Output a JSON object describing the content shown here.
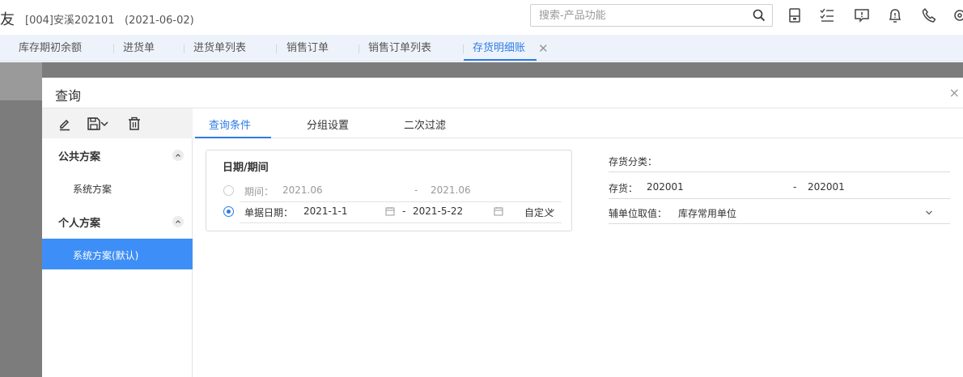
{
  "header": {
    "brand_fragment": "友",
    "account": "[004]安溪202101",
    "account_date": "(2021-06-02)",
    "search_placeholder": "搜索-产品功能",
    "icons": [
      "search-icon",
      "save-file-icon",
      "checklist-icon",
      "message-icon",
      "bell-icon",
      "phone-icon",
      "settings-icon"
    ]
  },
  "tabs": [
    {
      "label": "库存期初余额",
      "active": false
    },
    {
      "label": "进货单",
      "active": false
    },
    {
      "label": "进货单列表",
      "active": false
    },
    {
      "label": "销售订单",
      "active": false
    },
    {
      "label": "销售订单列表",
      "active": false
    },
    {
      "label": "存货明细账",
      "active": true
    }
  ],
  "dialog": {
    "title": "查询",
    "close": "×",
    "left": {
      "toolbar_icons": [
        "edit-icon",
        "save-icon",
        "chevron-down-icon",
        "delete-icon"
      ],
      "groups": [
        {
          "label": "公共方案",
          "schemes": [
            {
              "label": "系统方案",
              "selected": false
            }
          ]
        },
        {
          "label": "个人方案",
          "schemes": [
            {
              "label": "系统方案(默认)",
              "selected": true
            }
          ]
        }
      ]
    },
    "subtabs": [
      {
        "label": "查询条件",
        "active": true
      },
      {
        "label": "分组设置",
        "active": false
      },
      {
        "label": "二次过滤",
        "active": false
      }
    ],
    "date_section": {
      "title": "日期/期间",
      "period": {
        "label": "期间：",
        "from": "2021.06",
        "dash": "-",
        "to": "2021.06",
        "selected": false
      },
      "doc_date": {
        "label": "单据日期：",
        "from": "2021-1-1",
        "dash": "-",
        "to": "2021-5-22",
        "selected": true,
        "range_type": "自定义"
      }
    },
    "fields": {
      "category": {
        "label": "存货分类："
      },
      "inventory": {
        "label": "存货：",
        "from": "202001",
        "dash": "-",
        "to": "202001"
      },
      "aux_unit": {
        "label": "辅单位取值：",
        "value": "库存常用单位"
      }
    }
  },
  "colors": {
    "accent": "#2d7ce5",
    "selected_bg": "#3e8ef7",
    "overlay": "#7c7c7c",
    "tabbar_bg": "#eef3fb"
  }
}
